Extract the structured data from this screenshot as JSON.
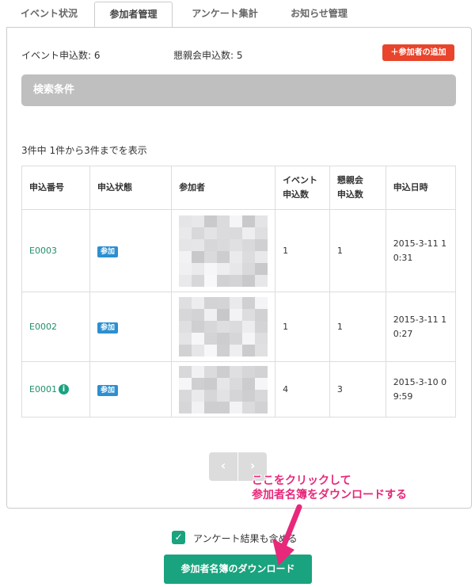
{
  "tabs": [
    {
      "label": "イベント状況",
      "active": false
    },
    {
      "label": "参加者管理",
      "active": true
    },
    {
      "label": "アンケート集計",
      "active": false
    },
    {
      "label": "お知らせ管理",
      "active": false
    }
  ],
  "summary": {
    "event_count": "イベント申込数: 6",
    "party_count": "懇親会申込数: 5",
    "add_button": "＋参加者の追加"
  },
  "search": {
    "title": "検索条件"
  },
  "results": {
    "text": "3件中 1件から3件までを表示"
  },
  "table": {
    "headers": [
      "申込番号",
      "申込状態",
      "参加者",
      "イベント\n申込数",
      "懇親会\n申込数",
      "申込日時"
    ],
    "rows": [
      {
        "id": "E0003",
        "status": "参加",
        "event": "1",
        "party": "1",
        "date": "2015-3-11 10:31",
        "info": false
      },
      {
        "id": "E0002",
        "status": "参加",
        "event": "1",
        "party": "1",
        "date": "2015-3-11 10:27",
        "info": false
      },
      {
        "id": "E0001",
        "status": "参加",
        "event": "4",
        "party": "3",
        "date": "2015-3-10 09:59",
        "info": true
      }
    ]
  },
  "pager": {
    "prev": "‹",
    "next": "›"
  },
  "checkbox": {
    "label": "アンケート結果も含める",
    "checked": true
  },
  "download_button": "参加者名簿のダウンロード",
  "annotation": {
    "line1": "ここをクリックして",
    "line2": "参加者名簿をダウンロードする"
  },
  "colors": {
    "accent": "#1aa37f",
    "add": "#e8452c",
    "badge": "#2c8fd1",
    "annotation": "#e8287a"
  }
}
